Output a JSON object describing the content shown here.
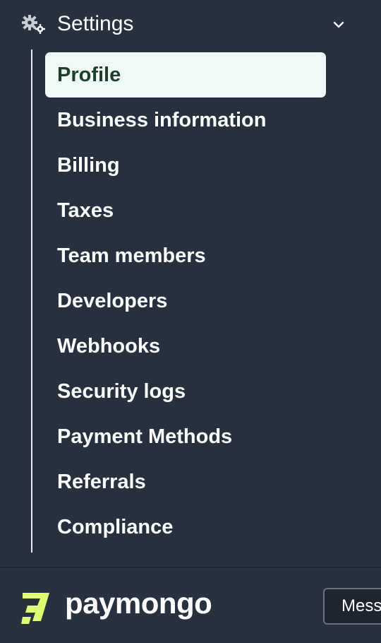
{
  "settings": {
    "label": "Settings",
    "icon": "gears-icon",
    "expand_icon": "chevron-down-icon"
  },
  "menu": {
    "items": [
      {
        "label": "Profile",
        "active": true
      },
      {
        "label": "Business information",
        "active": false
      },
      {
        "label": "Billing",
        "active": false
      },
      {
        "label": "Taxes",
        "active": false
      },
      {
        "label": "Team members",
        "active": false
      },
      {
        "label": "Developers",
        "active": false
      },
      {
        "label": "Webhooks",
        "active": false
      },
      {
        "label": "Security logs",
        "active": false
      },
      {
        "label": "Payment Methods",
        "active": false
      },
      {
        "label": "Referrals",
        "active": false
      },
      {
        "label": "Compliance",
        "active": false
      }
    ]
  },
  "footer": {
    "logo_text": "paymongo",
    "logo_icon": "paymongo-logo-icon",
    "message_button_label": "Messages"
  },
  "colors": {
    "sidebar_bg": "#26303f",
    "active_bg": "#eff9f5",
    "active_text": "#1d3f2e",
    "brand_lime": "#dffc6e",
    "text": "#ffffff"
  }
}
